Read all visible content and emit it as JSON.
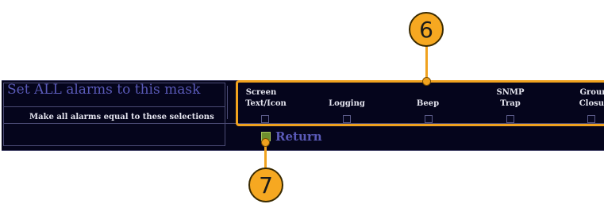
{
  "panel": {
    "title": "Set ALL alarms to this mask",
    "subtext": "Make all alarms equal to these selections"
  },
  "columns": [
    {
      "line1": "Screen",
      "line2": "Text/Icon"
    },
    {
      "line1": "",
      "line2": "Logging"
    },
    {
      "line1": "",
      "line2": "Beep"
    },
    {
      "line1": "SNMP",
      "line2": "Trap"
    },
    {
      "line1": "Groun",
      "line2": "Closur"
    }
  ],
  "return_button": {
    "label": "Return"
  },
  "callouts": {
    "top": "6",
    "bottom": "7"
  },
  "colors": {
    "callout": "#f6a821",
    "panel_bg": "#05051c",
    "title_text": "#5a5ab8",
    "return_icon": "#6e8f2e"
  }
}
